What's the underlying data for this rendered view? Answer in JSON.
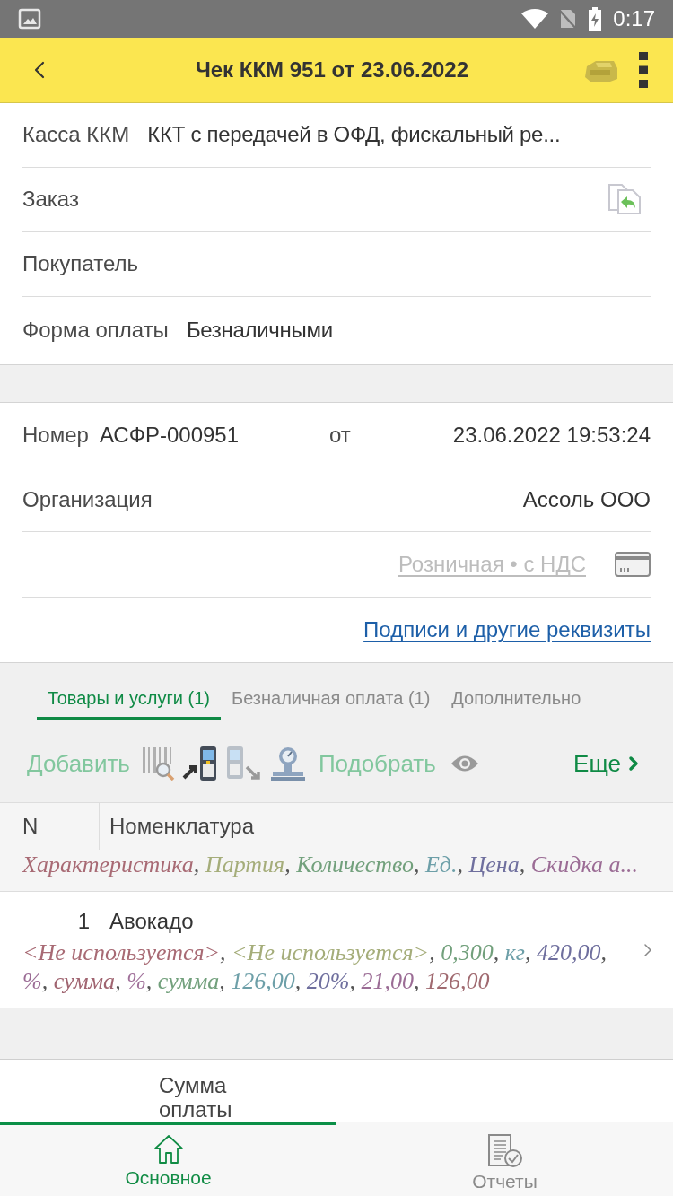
{
  "status_bar": {
    "time": "0:17"
  },
  "header": {
    "title": "Чек ККМ 951 от 23.06.2022"
  },
  "main_fields": [
    {
      "kind": "text",
      "label": "Касса ККМ",
      "value": "ККТ с передачей в ОФД, фискальный ре..."
    },
    {
      "kind": "reference",
      "label": "Заказ"
    },
    {
      "kind": "text",
      "label": "Покупатель"
    },
    {
      "kind": "text",
      "label": "Форма оплаты",
      "value": "Безналичными"
    }
  ],
  "document": {
    "number_label": "Номер",
    "number": "АСФР-000951",
    "date_label": "от",
    "date": "23.06.2022 19:53:24",
    "organization_label": "Организация",
    "organization": "Ассоль ООО",
    "price_type": "Розничная • с НДС",
    "details_link": "Подписи и другие реквизиты"
  },
  "tabs": [
    {
      "label": "Товары и услуги (1)",
      "selected": true
    },
    {
      "label": "Безналичная оплата (1)",
      "selected": false
    },
    {
      "label": "Дополнительно",
      "selected": false
    }
  ],
  "toolbar": {
    "add": {
      "label": "Добавить",
      "disabled": true
    },
    "pick": {
      "label": "Подобрать",
      "disabled": true
    },
    "more": {
      "label": "Еще",
      "disabled": false
    }
  },
  "table": {
    "columns": [
      "N",
      "Номенклатура"
    ],
    "subcolumns": [
      {
        "text": "Характеристика",
        "color": "#a86a74",
        "sep": ","
      },
      {
        "text": "Партия",
        "color": "#a5ad7a",
        "sep": ","
      },
      {
        "text": "Количество",
        "color": "#72a07c",
        "sep": ","
      },
      {
        "text": "Ед.",
        "color": "#6d9fa8",
        "sep": ","
      },
      {
        "text": "Цена",
        "color": "#6f6f9e",
        "sep": ","
      },
      {
        "text": "Скидка а...",
        "color": "#9b6c95"
      }
    ],
    "rows": [
      {
        "n": "1",
        "name": "Авокадо",
        "values": [
          {
            "text": "<Не используется>",
            "color": "#a86a74",
            "sep": ","
          },
          {
            "text": "<Не используется>",
            "color": "#a5ad7a",
            "sep": ","
          },
          {
            "text": "0,300",
            "color": "#72a07c",
            "sep": ","
          },
          {
            "text": "кг",
            "color": "#6d9fa8",
            "sep": ","
          },
          {
            "text": "420,00",
            "color": "#6f6f9e",
            "sep": ","
          },
          {
            "text": "%",
            "color": "#9b6c95",
            "sep": ","
          },
          {
            "text": "сумма",
            "color": "#a06470",
            "sep": ","
          },
          {
            "text": "%",
            "color": "#a0709a",
            "sep": ","
          },
          {
            "text": "сумма",
            "color": "#72a07c",
            "sep": ","
          },
          {
            "text": "126,00",
            "color": "#6d9fa8",
            "sep": ","
          },
          {
            "text": "20%",
            "color": "#6f6f9e",
            "sep": ","
          },
          {
            "text": "21,00",
            "color": "#9b6c95",
            "sep": ","
          },
          {
            "text": "126,00",
            "color": "#a06a70"
          }
        ]
      }
    ]
  },
  "summary": {
    "label": "Сумма оплаты"
  },
  "bottom_nav": [
    {
      "label": "Основное",
      "selected": true
    },
    {
      "label": "Отчеты",
      "selected": false
    }
  ]
}
